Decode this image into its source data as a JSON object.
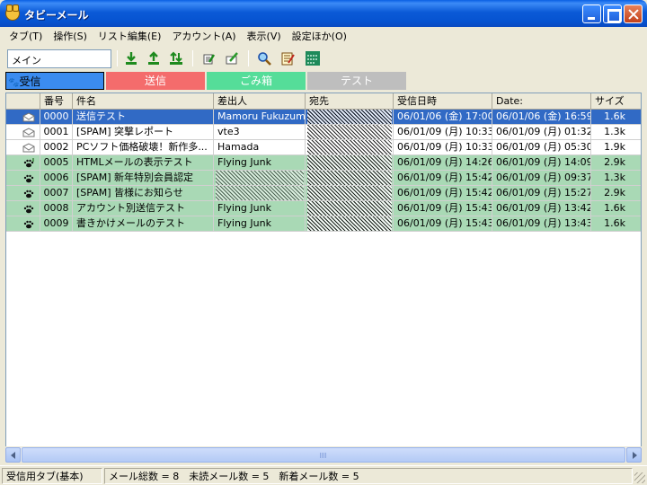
{
  "window": {
    "title": "タビーメール"
  },
  "menu": [
    "タブ(T)",
    "操作(S)",
    "リスト編集(E)",
    "アカウント(A)",
    "表示(V)",
    "設定ほか(O)"
  ],
  "toolbar": {
    "mailbox": "メイン",
    "buttons": [
      "receive-icon",
      "send-icon",
      "send-receive-icon",
      "compose-icon",
      "edit-icon",
      "search-icon",
      "notepad-icon",
      "shortcut-icon"
    ]
  },
  "tabs": [
    {
      "label": "受信",
      "color": "#3B8CF0"
    },
    {
      "label": "送信",
      "color": "#F46C6C"
    },
    {
      "label": "ごみ箱",
      "color": "#55DD99"
    },
    {
      "label": "テスト",
      "color": "#BEBEBE"
    }
  ],
  "columns": [
    "",
    "番号",
    "件名",
    "差出人",
    "宛先",
    "受信日時",
    "Date:",
    "サイズ"
  ],
  "rows": [
    {
      "icon": "envelope-open",
      "bg": "#316AC5",
      "selected": true,
      "num": "0000",
      "subject": "送信テスト",
      "from": "Mamoru Fukuzumi",
      "to_blurred": true,
      "received": "06/01/06 (金) 17:00",
      "date": "06/01/06 (金) 16:59",
      "size": "1.6k"
    },
    {
      "icon": "envelope-open",
      "bg": "#FFFFFF",
      "num": "0001",
      "subject": "[SPAM] 突撃レポート",
      "from": "vte3",
      "to_blurred": true,
      "received": "06/01/09 (月) 10:33",
      "date": "06/01/09 (月) 01:32",
      "size": "1.3k"
    },
    {
      "icon": "envelope-open",
      "bg": "#FFFFFF",
      "num": "0002",
      "subject": "PCソフト価格破壊！新作多...",
      "from": "Hamada",
      "to_blurred": true,
      "received": "06/01/09 (月) 10:33",
      "date": "06/01/09 (月) 05:30",
      "size": "1.9k"
    },
    {
      "icon": "paw-attach",
      "bg": "#A9D9B5",
      "num": "0005",
      "subject": "HTMLメールの表示テスト",
      "from": "Flying Junk",
      "to_blurred": true,
      "received": "06/01/09 (月) 14:26",
      "date": "06/01/09 (月) 14:09",
      "size": "2.9k"
    },
    {
      "icon": "paw",
      "bg": "#A9D9B5",
      "num": "0006",
      "subject": "[SPAM] 新年特別会員認定",
      "from": "",
      "from_blurred": true,
      "to_blurred": true,
      "received": "06/01/09 (月) 15:42",
      "date": "06/01/09 (月) 09:37",
      "size": "1.3k"
    },
    {
      "icon": "paw",
      "bg": "#A9D9B5",
      "num": "0007",
      "subject": "[SPAM] 皆様にお知らせ",
      "from": "",
      "from_blurred": true,
      "to_blurred": true,
      "received": "06/01/09 (月) 15:42",
      "date": "06/01/09 (月) 15:27",
      "size": "2.9k"
    },
    {
      "icon": "paw",
      "bg": "#A9D9B5",
      "num": "0008",
      "subject": "アカウント別送信テスト",
      "from": "Flying Junk",
      "to_blurred": true,
      "received": "06/01/09 (月) 15:43",
      "date": "06/01/09 (月) 13:42",
      "size": "1.6k"
    },
    {
      "icon": "paw",
      "bg": "#A9D9B5",
      "num": "0009",
      "subject": "書きかけメールのテスト",
      "from": "Flying Junk",
      "to_blurred": true,
      "received": "06/01/09 (月) 15:43",
      "date": "06/01/09 (月) 13:43",
      "size": "1.6k"
    }
  ],
  "status": {
    "tab_info": "受信用タブ(基本)",
    "counts": "メール総数 = 8　未読メール数 = 5　新着メール数 = 5"
  }
}
